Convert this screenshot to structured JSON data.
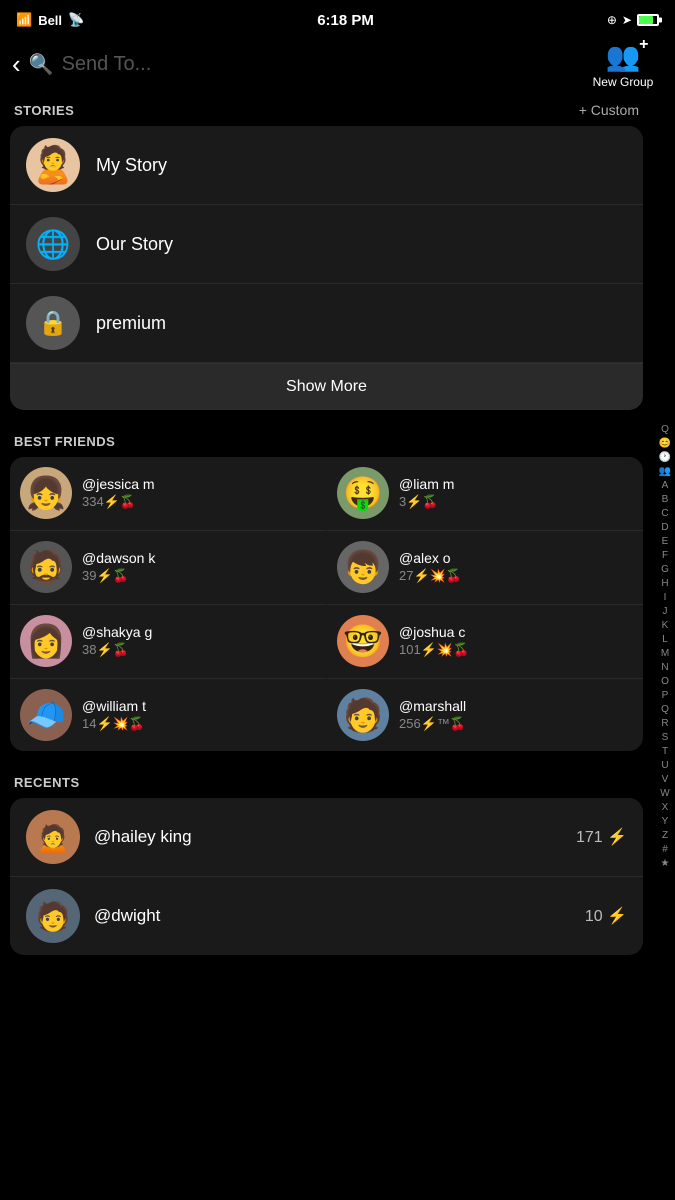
{
  "statusBar": {
    "carrier": "Bell",
    "time": "6:18 PM",
    "icons": [
      "location",
      "battery"
    ]
  },
  "header": {
    "searchPlaceholder": "Send To...",
    "newGroupLabel": "New Group",
    "newGroupPlus": "+"
  },
  "stories": {
    "sectionTitle": "STORIES",
    "customBtn": "+ Custom",
    "items": [
      {
        "id": "my-story",
        "name": "My Story",
        "avatarType": "bitmoji"
      },
      {
        "id": "our-story",
        "name": "Our Story",
        "avatarType": "globe"
      },
      {
        "id": "premium",
        "name": "premium",
        "avatarType": "lock"
      }
    ],
    "showMoreLabel": "Show More"
  },
  "bestFriends": {
    "sectionTitle": "BEST FRIENDS",
    "items": [
      {
        "id": "jessica",
        "name": "@jessica m",
        "score": "334⚡🍒",
        "avatarEmoji": "👩"
      },
      {
        "id": "liam",
        "name": "@liam m",
        "score": "3⚡🍒",
        "avatarEmoji": "🤑"
      },
      {
        "id": "dawson",
        "name": "@dawson k",
        "score": "39⚡🍒",
        "avatarEmoji": "🧑"
      },
      {
        "id": "alex",
        "name": "@alex o",
        "score": "27⚡💥🍒",
        "avatarEmoji": "👦"
      },
      {
        "id": "shakya",
        "name": "@shakya g",
        "score": "38⚡🍒",
        "avatarEmoji": "👧"
      },
      {
        "id": "joshua",
        "name": "@joshua c",
        "score": "101⚡💥🍒",
        "avatarEmoji": "🧑"
      },
      {
        "id": "william",
        "name": "@william t",
        "score": "14⚡💥🍒",
        "avatarEmoji": "👤"
      },
      {
        "id": "marshall",
        "name": "@marshall",
        "score": "256⚡™🍒",
        "avatarEmoji": "👤"
      }
    ]
  },
  "recents": {
    "sectionTitle": "RECENTS",
    "items": [
      {
        "id": "hailey",
        "name": "@hailey king",
        "score": "171 ⚡",
        "avatarEmoji": "👩"
      },
      {
        "id": "dwight",
        "name": "@dwight",
        "score": "10 ⚡",
        "avatarEmoji": "🧑"
      }
    ]
  },
  "alphaSidebar": [
    "Q",
    "😊",
    "🕐",
    "👥",
    "A",
    "B",
    "C",
    "D",
    "E",
    "F",
    "G",
    "H",
    "I",
    "J",
    "K",
    "L",
    "M",
    "N",
    "O",
    "P",
    "Q",
    "R",
    "S",
    "T",
    "U",
    "V",
    "W",
    "X",
    "Y",
    "Z",
    "#",
    "★"
  ]
}
